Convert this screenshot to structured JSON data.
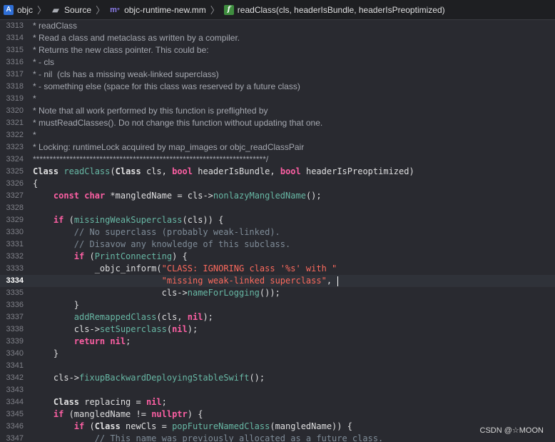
{
  "jumpbar": {
    "project": "objc",
    "folder": "Source",
    "file": "objc-runtime-new.mm",
    "symbol": "readClass(cls, headerIsBundle, headerIsPreoptimized)"
  },
  "editor": {
    "current_line": "3334",
    "lines": [
      {
        "num": "3313",
        "doc": "* readClass"
      },
      {
        "num": "3314",
        "doc": "* Read a class and metaclass as written by a compiler."
      },
      {
        "num": "3315",
        "doc": "* Returns the new class pointer. This could be:"
      },
      {
        "num": "3316",
        "doc": "* - cls"
      },
      {
        "num": "3317",
        "doc": "* - nil  (cls has a missing weak-linked superclass)"
      },
      {
        "num": "3318",
        "doc": "* - something else (space for this class was reserved by a future class)"
      },
      {
        "num": "3319",
        "doc": "*"
      },
      {
        "num": "3320",
        "doc": "* Note that all work performed by this function is preflighted by"
      },
      {
        "num": "3321",
        "doc": "* mustReadClasses(). Do not change this function without updating that one."
      },
      {
        "num": "3322",
        "doc": "*"
      },
      {
        "num": "3323",
        "doc": "* Locking: runtimeLock acquired by map_images or objc_readClassPair"
      },
      {
        "num": "3324",
        "doc": "**********************************************************************/"
      },
      {
        "num": "3325",
        "tokens": [
          [
            "Class ",
            "t-type"
          ],
          [
            "readClass",
            "t-func"
          ],
          [
            "(",
            "t-plain"
          ],
          [
            "Class",
            "t-type"
          ],
          [
            " cls, ",
            "t-plain"
          ],
          [
            "bool",
            "t-kw"
          ],
          [
            " headerIsBundle, ",
            "t-plain"
          ],
          [
            "bool",
            "t-kw"
          ],
          [
            " headerIsPreoptimized)",
            "t-plain"
          ]
        ]
      },
      {
        "num": "3326",
        "tokens": [
          [
            "{",
            "t-plain"
          ]
        ]
      },
      {
        "num": "3327",
        "tokens": [
          [
            "    ",
            "t-plain"
          ],
          [
            "const",
            "t-kw"
          ],
          [
            " ",
            "t-plain"
          ],
          [
            "char",
            "t-kw"
          ],
          [
            " *mangledName = cls->",
            "t-plain"
          ],
          [
            "nonlazyMangledName",
            "t-func"
          ],
          [
            "();",
            "t-plain"
          ]
        ]
      },
      {
        "num": "3328",
        "tokens": []
      },
      {
        "num": "3329",
        "tokens": [
          [
            "    ",
            "t-plain"
          ],
          [
            "if",
            "t-kw"
          ],
          [
            " (",
            "t-plain"
          ],
          [
            "missingWeakSuperclass",
            "t-func"
          ],
          [
            "(cls)) {",
            "t-plain"
          ]
        ]
      },
      {
        "num": "3330",
        "tokens": [
          [
            "        // No superclass (probably weak-linked).",
            "t-cmt"
          ]
        ]
      },
      {
        "num": "3331",
        "tokens": [
          [
            "        // Disavow any knowledge of this subclass.",
            "t-cmt"
          ]
        ]
      },
      {
        "num": "3332",
        "tokens": [
          [
            "        ",
            "t-plain"
          ],
          [
            "if",
            "t-kw"
          ],
          [
            " (",
            "t-plain"
          ],
          [
            "PrintConnecting",
            "t-func"
          ],
          [
            ") {",
            "t-plain"
          ]
        ]
      },
      {
        "num": "3333",
        "tokens": [
          [
            "            _objc_inform(",
            "t-plain"
          ],
          [
            "\"CLASS: IGNORING class '%s' with \"",
            "t-str"
          ]
        ]
      },
      {
        "num": "3334",
        "tokens": [
          [
            "                         ",
            "t-plain"
          ],
          [
            "\"missing weak-linked superclass\"",
            "t-str"
          ],
          [
            ",",
            "t-plain"
          ]
        ],
        "caret": true
      },
      {
        "num": "3335",
        "tokens": [
          [
            "                         cls->",
            "t-plain"
          ],
          [
            "nameForLogging",
            "t-func"
          ],
          [
            "());",
            "t-plain"
          ]
        ]
      },
      {
        "num": "3336",
        "tokens": [
          [
            "        }",
            "t-plain"
          ]
        ]
      },
      {
        "num": "3337",
        "tokens": [
          [
            "        ",
            "t-plain"
          ],
          [
            "addRemappedClass",
            "t-func"
          ],
          [
            "(cls, ",
            "t-plain"
          ],
          [
            "nil",
            "t-kw"
          ],
          [
            ");",
            "t-plain"
          ]
        ]
      },
      {
        "num": "3338",
        "tokens": [
          [
            "        cls->",
            "t-plain"
          ],
          [
            "setSuperclass",
            "t-func"
          ],
          [
            "(",
            "t-plain"
          ],
          [
            "nil",
            "t-kw"
          ],
          [
            ");",
            "t-plain"
          ]
        ]
      },
      {
        "num": "3339",
        "tokens": [
          [
            "        ",
            "t-plain"
          ],
          [
            "return",
            "t-kw"
          ],
          [
            " ",
            "t-plain"
          ],
          [
            "nil",
            "t-kw"
          ],
          [
            ";",
            "t-plain"
          ]
        ]
      },
      {
        "num": "3340",
        "tokens": [
          [
            "    }",
            "t-plain"
          ]
        ]
      },
      {
        "num": "3341",
        "tokens": []
      },
      {
        "num": "3342",
        "tokens": [
          [
            "    cls->",
            "t-plain"
          ],
          [
            "fixupBackwardDeployingStableSwift",
            "t-func"
          ],
          [
            "();",
            "t-plain"
          ]
        ]
      },
      {
        "num": "3343",
        "tokens": []
      },
      {
        "num": "3344",
        "tokens": [
          [
            "    ",
            "t-plain"
          ],
          [
            "Class",
            "t-type"
          ],
          [
            " replacing = ",
            "t-plain"
          ],
          [
            "nil",
            "t-kw"
          ],
          [
            ";",
            "t-plain"
          ]
        ]
      },
      {
        "num": "3345",
        "tokens": [
          [
            "    ",
            "t-plain"
          ],
          [
            "if",
            "t-kw"
          ],
          [
            " (mangledName != ",
            "t-plain"
          ],
          [
            "nullptr",
            "t-kw"
          ],
          [
            ") {",
            "t-plain"
          ]
        ]
      },
      {
        "num": "3346",
        "tokens": [
          [
            "        ",
            "t-plain"
          ],
          [
            "if",
            "t-kw"
          ],
          [
            " (",
            "t-plain"
          ],
          [
            "Class",
            "t-type"
          ],
          [
            " newCls = ",
            "t-plain"
          ],
          [
            "popFutureNamedClass",
            "t-func"
          ],
          [
            "(mangledName)) {",
            "t-plain"
          ]
        ]
      },
      {
        "num": "3347",
        "tokens": [
          [
            "            // This name was previously allocated as a future class.",
            "t-cmt"
          ]
        ]
      }
    ]
  },
  "watermark": "CSDN @☆MOON"
}
